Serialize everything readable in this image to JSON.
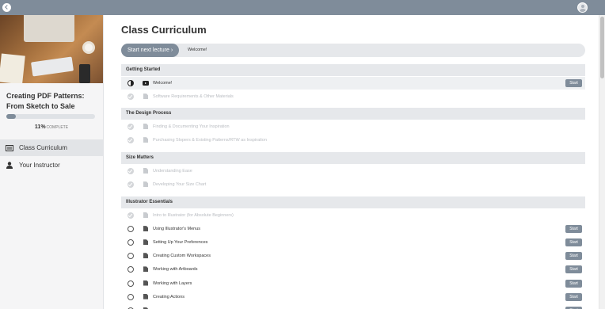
{
  "colors": {
    "accent": "#7f8c9a",
    "section_bg": "#e6e8eb",
    "sidebar_bg": "#f5f5f6"
  },
  "topbar": {
    "back_icon": "back-arrow-icon",
    "avatar_icon": "user-avatar-icon"
  },
  "sidebar": {
    "course_title": "Creating PDF Patterns: From Sketch to Sale",
    "progress": {
      "percent": 11,
      "percent_label": "11%",
      "complete_label": "COMPLETE"
    },
    "nav": [
      {
        "label": "Class Curriculum",
        "icon": "curriculum-icon",
        "active": true
      },
      {
        "label": "Your Instructor",
        "icon": "user-icon",
        "active": false
      }
    ]
  },
  "main": {
    "title": "Class Curriculum",
    "next_button": "Start next lecture ›",
    "next_lecture": "Welcome!",
    "start_label": "Start",
    "sections": [
      {
        "title": "Getting Started",
        "lectures": [
          {
            "title": "Welcome!",
            "type": "video",
            "status": "in-progress",
            "start": true
          },
          {
            "title": "Software Requirements & Other Materials",
            "type": "doc",
            "status": "complete",
            "start": false
          }
        ]
      },
      {
        "title": "The Design Process",
        "lectures": [
          {
            "title": "Finding & Documenting Your Inspiration",
            "type": "doc",
            "status": "complete",
            "start": false
          },
          {
            "title": "Purchasing Slopers & Existing Patterns/RTW as Inspiration",
            "type": "doc",
            "status": "complete",
            "start": false
          }
        ]
      },
      {
        "title": "Size Matters",
        "lectures": [
          {
            "title": "Understanding Ease",
            "type": "doc",
            "status": "complete",
            "start": false
          },
          {
            "title": "Developing Your Size Chart",
            "type": "doc",
            "status": "complete",
            "start": false
          }
        ]
      },
      {
        "title": "Illustrator Essentials",
        "lectures": [
          {
            "title": "Intro to Illustrator (for Absolute Beginners)",
            "type": "doc",
            "status": "complete",
            "start": false
          },
          {
            "title": "Using Illustrator's Menus",
            "type": "doc",
            "status": "open",
            "start": true
          },
          {
            "title": "Setting Up Your Preferences",
            "type": "doc",
            "status": "open",
            "start": true
          },
          {
            "title": "Creating Custom Workspaces",
            "type": "doc",
            "status": "open",
            "start": true
          },
          {
            "title": "Working with Artboards",
            "type": "doc",
            "status": "open",
            "start": true
          },
          {
            "title": "Working with Layers",
            "type": "doc",
            "status": "open",
            "start": true
          },
          {
            "title": "Creating Actions",
            "type": "doc",
            "status": "open",
            "start": true
          },
          {
            "title": "",
            "type": "doc",
            "status": "open",
            "start": true
          }
        ]
      }
    ]
  }
}
